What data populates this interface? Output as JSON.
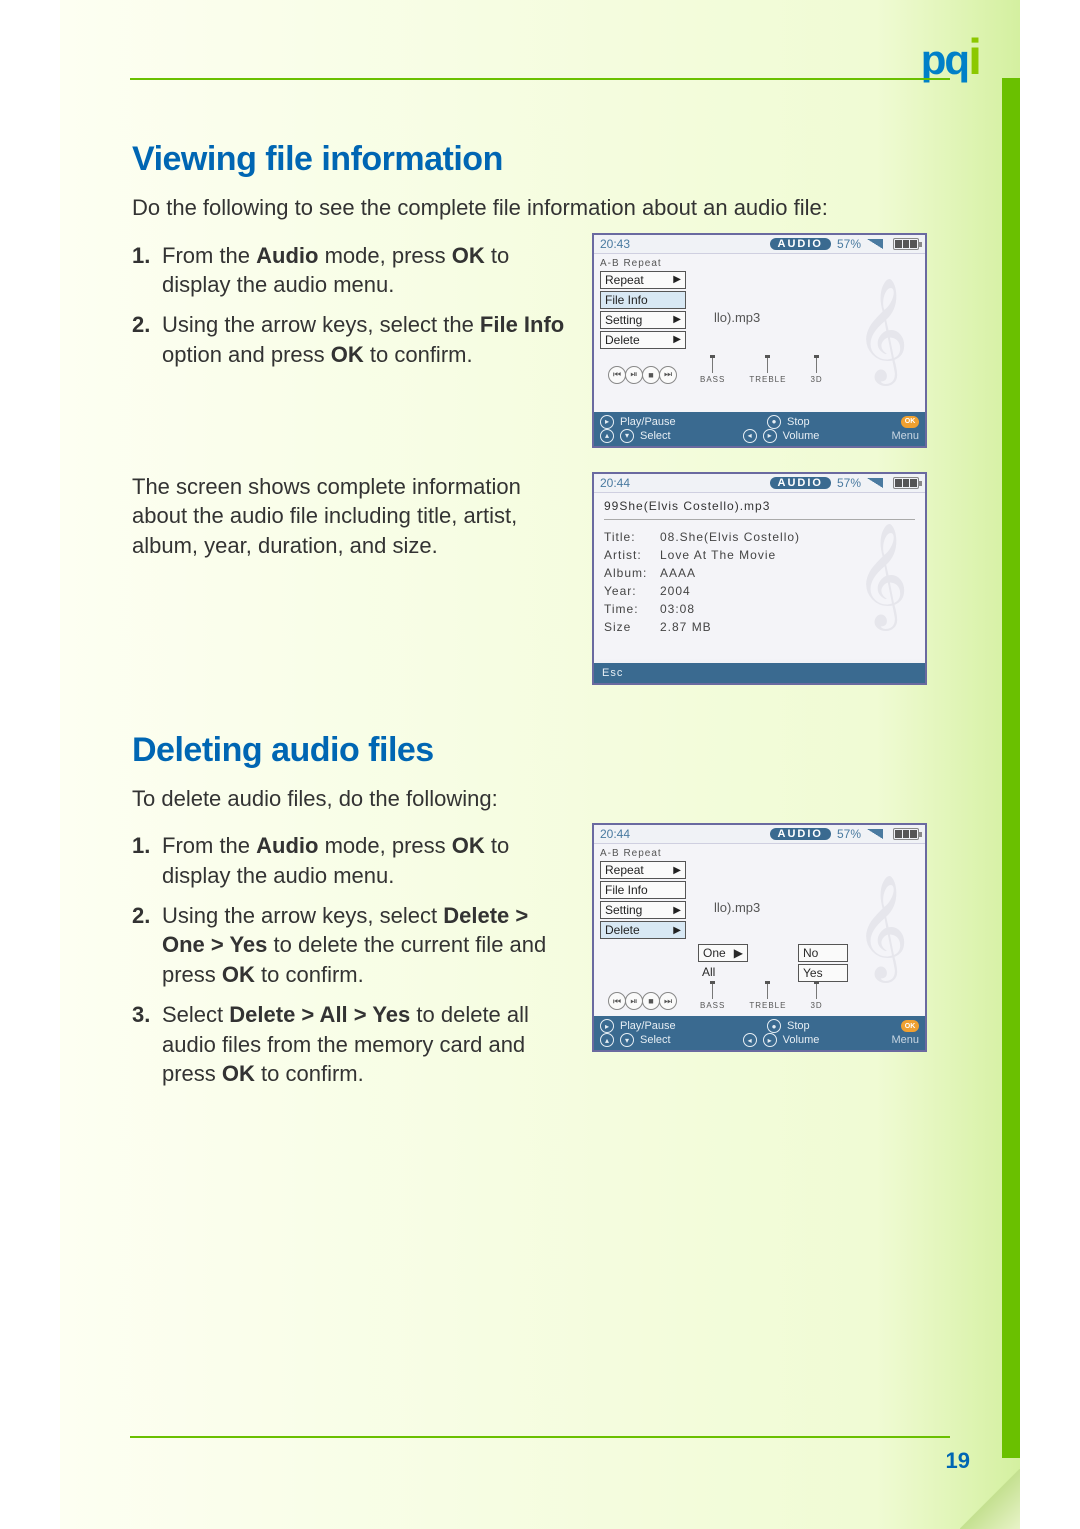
{
  "logo": {
    "text": "pq",
    "accent": "i"
  },
  "page_number": "19",
  "section1": {
    "title": "Viewing file information",
    "intro": "Do the following to see the complete file information about an audio file:",
    "steps": [
      {
        "num": "1.",
        "pre": "From the ",
        "b1": "Audio",
        "mid": " mode, press ",
        "b2": "OK",
        "post": " to display the audio menu."
      },
      {
        "num": "2.",
        "pre": "Using the arrow keys, select the ",
        "b1": "File Info",
        "mid": " option and press ",
        "b2": "OK",
        "post": " to confirm."
      }
    ],
    "result": "The screen shows complete information about the audio file including title, artist, album, year, duration, and size."
  },
  "section2": {
    "title": "Deleting audio files",
    "intro": "To delete audio files, do the following:",
    "steps": [
      {
        "num": "1.",
        "pre": "From the ",
        "b1": "Audio",
        "mid": " mode, press ",
        "b2": "OK",
        "post": " to display the audio menu."
      },
      {
        "num": "2.",
        "pre": "Using the arrow keys, select ",
        "b1": "Delete > One > Yes",
        "mid": " to delete the current file and press ",
        "b2": "OK",
        "post": " to confirm."
      },
      {
        "num": "3.",
        "pre": "Select ",
        "b1": "Delete > All > Yes",
        "mid": " to delete all audio files from the memory card and press ",
        "b2": "OK",
        "post": " to confirm."
      }
    ]
  },
  "device_common": {
    "audio_pill": "AUDIO",
    "percent": "57%",
    "menu": {
      "header": "A-B Repeat",
      "items": [
        "Repeat",
        "File Info",
        "Setting",
        "Delete"
      ]
    },
    "bg_filename": "llo).mp3",
    "eq": {
      "bass": "BASS",
      "treble": "TREBLE",
      "threeD": "3D"
    },
    "footer": {
      "play": "Play/Pause",
      "stop": "Stop",
      "select": "Select",
      "volume": "Volume",
      "ok": "OK",
      "menu": "Menu"
    }
  },
  "shot1": {
    "time": "20:43",
    "selected": "File Info"
  },
  "shot2": {
    "time": "20:44",
    "filename": "99She(Elvis Costello).mp3",
    "fields": [
      {
        "k": "Title:",
        "v": "08.She(Elvis Costello)"
      },
      {
        "k": "Artist:",
        "v": "Love At The Movie"
      },
      {
        "k": "Album:",
        "v": "AAAA"
      },
      {
        "k": "Year:",
        "v": "2004"
      },
      {
        "k": "Time:",
        "v": "03:08"
      },
      {
        "k": "Size",
        "v": "2.87 MB"
      }
    ],
    "esc": "Esc"
  },
  "shot3": {
    "time": "20:44",
    "selected": "Delete",
    "submenu1": [
      "One",
      "All"
    ],
    "submenu2": [
      "No",
      "Yes"
    ]
  }
}
